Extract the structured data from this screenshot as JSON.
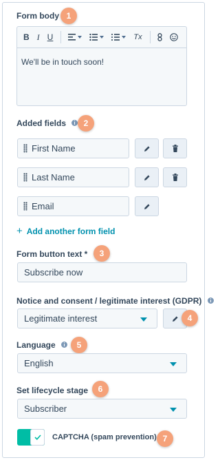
{
  "form_body": {
    "label": "Form body",
    "badge": "1",
    "toolbar": {
      "bold": "B",
      "italic": "I",
      "underline": "U",
      "clear": "Tx"
    },
    "content": "We'll be in touch soon!"
  },
  "added_fields": {
    "label": "Added fields",
    "badge": "2",
    "fields": [
      {
        "label": "First Name"
      },
      {
        "label": "Last Name"
      },
      {
        "label": "Email"
      }
    ],
    "add_link": "Add another form field"
  },
  "button_text": {
    "label": "Form button text *",
    "badge": "3",
    "value": "Subscribe now"
  },
  "consent": {
    "label": "Notice and consent / legitimate interest (GDPR)",
    "badge": "4",
    "value": "Legitimate interest"
  },
  "language": {
    "label": "Language",
    "badge": "5",
    "value": "English"
  },
  "lifecycle": {
    "label": "Set lifecycle stage",
    "badge": "6",
    "value": "Subscriber"
  },
  "captcha": {
    "label": "CAPTCHA (spam prevention)",
    "badge": "7",
    "enabled": true
  },
  "colors": {
    "accent": "#0091ae",
    "toggle_on": "#00bda5",
    "badge": "#f5a27a",
    "text": "#33475b",
    "border": "#cbd6e2"
  }
}
